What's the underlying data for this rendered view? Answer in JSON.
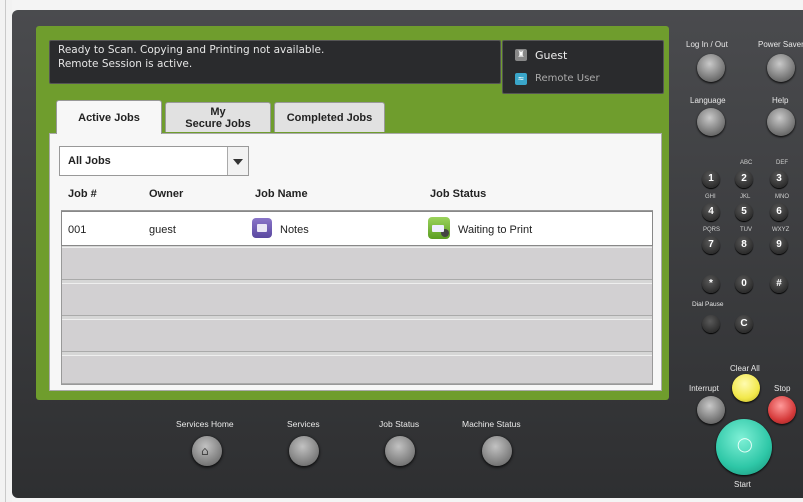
{
  "message_bar": {
    "text": "Ready to Scan.  Copying and Printing not available.\nRemote Session is active."
  },
  "user_panel": {
    "user_name": "Guest",
    "session_type": "Remote User"
  },
  "tabs": [
    {
      "label": "Active Jobs",
      "active": true
    },
    {
      "label": "My\nSecure Jobs",
      "active": false
    },
    {
      "label": "Completed Jobs",
      "active": false
    }
  ],
  "filter": {
    "selected": "All Jobs"
  },
  "table": {
    "columns": [
      "Job #",
      "Owner",
      "Job Name",
      "Job Status"
    ],
    "rows": [
      {
        "job_number": "001",
        "owner": "guest",
        "job_name": "Notes",
        "job_status": "Waiting to Print",
        "name_icon": "notes-icon",
        "status_icon": "printer-icon"
      }
    ],
    "empty_rows": 4
  },
  "bottom_nav": [
    {
      "label": "Services Home",
      "icon": "home-icon"
    },
    {
      "label": "Services"
    },
    {
      "label": "Job Status"
    },
    {
      "label": "Machine Status"
    }
  ],
  "control_panel": {
    "log_in_out": "Log In / Out",
    "power_saver": "Power Saver",
    "language": "Language",
    "help": "Help",
    "keypad": [
      {
        "digit": "1",
        "letters": ""
      },
      {
        "digit": "2",
        "letters": "ABC"
      },
      {
        "digit": "3",
        "letters": "DEF"
      },
      {
        "digit": "4",
        "letters": "GHI"
      },
      {
        "digit": "5",
        "letters": "JKL"
      },
      {
        "digit": "6",
        "letters": "MNO"
      },
      {
        "digit": "7",
        "letters": "PQRS"
      },
      {
        "digit": "8",
        "letters": "TUV"
      },
      {
        "digit": "9",
        "letters": "WXYZ"
      },
      {
        "digit": "*",
        "letters": ""
      },
      {
        "digit": "0",
        "letters": ""
      },
      {
        "digit": "#",
        "letters": ""
      }
    ],
    "dial_pause": "Dial Pause",
    "clear": "C",
    "clear_all": "Clear All",
    "interrupt": "Interrupt",
    "stop": "Stop",
    "start": "Start"
  },
  "colors": {
    "frame_green": "#6f9d2d",
    "start_teal": "#2ec7a7",
    "clear_all_yellow": "#f2e84b",
    "stop_red": "#d63b3b"
  }
}
